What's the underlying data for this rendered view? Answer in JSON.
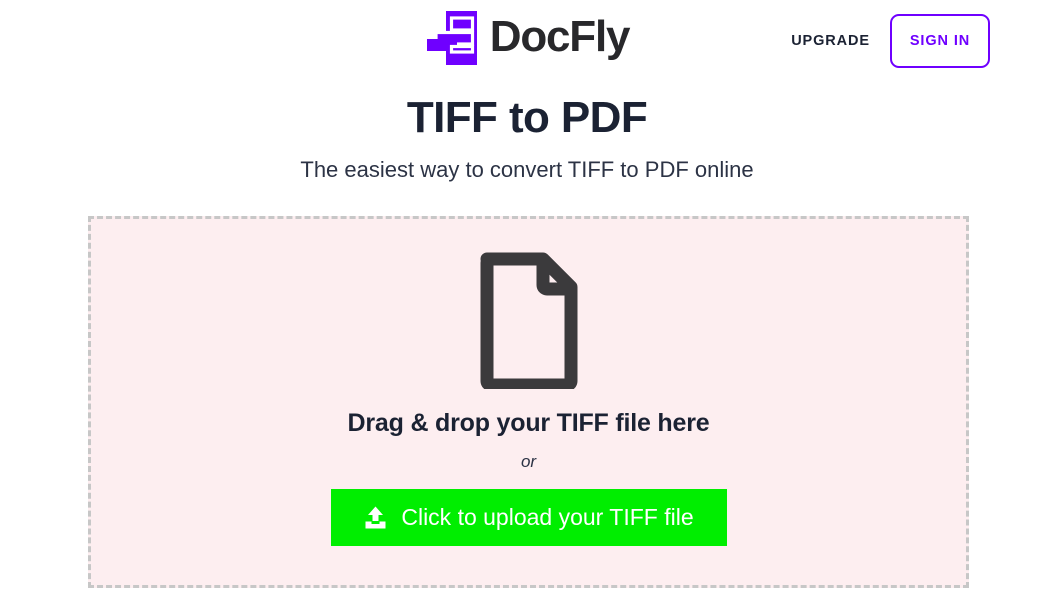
{
  "header": {
    "logo_icon": "docfly-stacked-document-logo",
    "brand_name": "DocFly",
    "brand_color": "#6f00ff",
    "upgrade_label": "UPGRADE",
    "signin_label": "SIGN IN"
  },
  "hero": {
    "title": "TIFF to PDF",
    "subtitle": "The easiest way to convert TIFF to PDF online"
  },
  "dropzone": {
    "document_icon": "document-page-icon",
    "headline": "Drag & drop your TIFF file here",
    "separator": "or",
    "background_color": "#fdeef0",
    "border_color": "#c7c7c7",
    "upload_button": {
      "icon": "upload-arrow-icon",
      "label": "Click to upload your TIFF file",
      "background_color": "#00ee00",
      "text_color": "#ffffff"
    }
  }
}
